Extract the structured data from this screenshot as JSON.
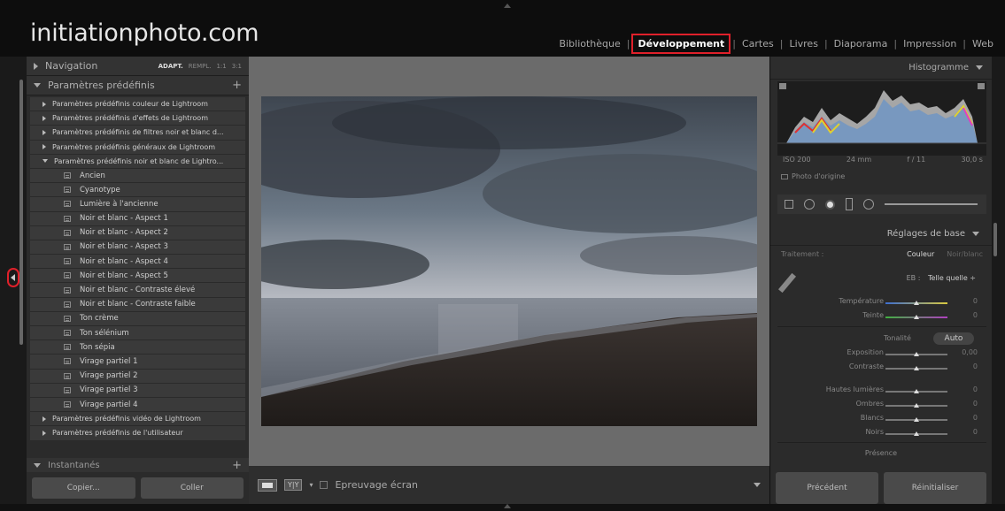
{
  "brand": "initiationphoto.com",
  "modules": [
    "Bibliothèque",
    "Développement",
    "Cartes",
    "Livres",
    "Diaporama",
    "Impression",
    "Web"
  ],
  "colors": {
    "highlight_red": "#e0202a",
    "panel": "#2b2b2b",
    "center_bg": "#6b6b6b"
  },
  "left": {
    "navigation": {
      "title": "Navigation",
      "options": [
        "ADAPT.",
        "REMPL.",
        "1:1",
        "3:1"
      ]
    },
    "presets": {
      "title": "Paramètres prédéfinis",
      "folders_top": [
        "Paramètres prédéfinis couleur de Lightroom",
        "Paramètres prédéfinis d'effets de Lightroom",
        "Paramètres prédéfinis de filtres noir et blanc d...",
        "Paramètres prédéfinis généraux de Lightroom"
      ],
      "open_folder": "Paramètres prédéfinis noir et blanc de Lightro...",
      "items": [
        "Ancien",
        "Cyanotype",
        "Lumière à l'ancienne",
        "Noir et blanc - Aspect 1",
        "Noir et blanc - Aspect 2",
        "Noir et blanc - Aspect 3",
        "Noir et blanc - Aspect 4",
        "Noir et blanc - Aspect 5",
        "Noir et blanc - Contraste élevé",
        "Noir et blanc - Contraste faible",
        "Ton crème",
        "Ton sélénium",
        "Ton sépia",
        "Virage partiel 1",
        "Virage partiel 2",
        "Virage partiel 3",
        "Virage partiel 4"
      ],
      "folders_bottom": [
        "Paramètres prédéfinis vidéo de Lightroom",
        "Paramètres prédéfinis de l'utilisateur"
      ]
    },
    "snapshots": {
      "title": "Instantanés"
    },
    "buttons": {
      "copy": "Copier...",
      "paste": "Coller"
    }
  },
  "toolbar": {
    "yy": "Y|Y",
    "proof": "Epreuvage écran"
  },
  "right": {
    "histogram": {
      "title": "Histogramme",
      "iso": "ISO 200",
      "focal": "24 mm",
      "aperture": "f / 11",
      "shutter": "30,0 s",
      "original": "Photo d'origine"
    },
    "basic": {
      "title": "Réglages de base",
      "treatment_label": "Traitement :",
      "treatment_color": "Couleur",
      "treatment_bw": "Noir/blanc",
      "wb_label": "EB :",
      "wb_value": "Telle quelle ÷",
      "temp": {
        "label": "Température",
        "value": "0",
        "level": 0.5
      },
      "tint": {
        "label": "Teinte",
        "value": "0",
        "level": 0.5
      },
      "tone_label": "Tonalité",
      "auto": "Auto",
      "exposure": {
        "label": "Exposition",
        "value": "0,00",
        "level": 0.5
      },
      "contrast": {
        "label": "Contraste",
        "value": "0",
        "level": 0.5
      },
      "highlights": {
        "label": "Hautes lumières",
        "value": "0",
        "level": 0.5
      },
      "shadows": {
        "label": "Ombres",
        "value": "0",
        "level": 0.5
      },
      "whites": {
        "label": "Blancs",
        "value": "0",
        "level": 0.5
      },
      "blacks": {
        "label": "Noirs",
        "value": "0",
        "level": 0.5
      },
      "presence": "Présence"
    },
    "buttons": {
      "previous": "Précédent",
      "reset": "Réinitialiser"
    }
  }
}
